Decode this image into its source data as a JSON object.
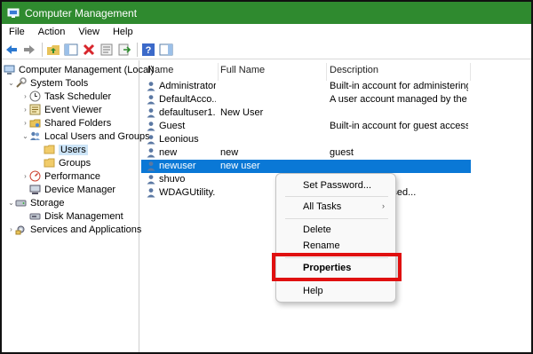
{
  "window": {
    "title": "Computer Management"
  },
  "menu": [
    "File",
    "Action",
    "View",
    "Help"
  ],
  "toolbar": {
    "buttons": [
      "back-icon",
      "forward-icon",
      "up-folder-icon",
      "show-hide-tree-icon",
      "delete-icon",
      "properties-icon",
      "export-icon",
      "help-icon",
      "action-pane-icon"
    ]
  },
  "tree": {
    "root": "Computer Management (Local)",
    "system_tools": "System Tools",
    "task_scheduler": "Task Scheduler",
    "event_viewer": "Event Viewer",
    "shared_folders": "Shared Folders",
    "local_users_groups": "Local Users and Groups",
    "users": "Users",
    "groups": "Groups",
    "performance": "Performance",
    "device_manager": "Device Manager",
    "storage": "Storage",
    "disk_management": "Disk Management",
    "services_apps": "Services and Applications"
  },
  "columns": {
    "name": "Name",
    "full_name": "Full Name",
    "description": "Description"
  },
  "users": [
    {
      "name": "Administrator",
      "full_name": "",
      "description": "Built-in account for administering ..."
    },
    {
      "name": "DefaultAcco...",
      "full_name": "",
      "description": "A user account managed by the sy..."
    },
    {
      "name": "defaultuser1...",
      "full_name": "New User",
      "description": ""
    },
    {
      "name": "Guest",
      "full_name": "",
      "description": "Built-in account for guest access t..."
    },
    {
      "name": "Leonious",
      "full_name": "",
      "description": ""
    },
    {
      "name": "new",
      "full_name": "new",
      "description": "guest"
    },
    {
      "name": "newuser",
      "full_name": "new user",
      "description": "",
      "selected": true
    },
    {
      "name": "shuvo",
      "full_name": "",
      "description": ""
    },
    {
      "name": "WDAGUtility...",
      "full_name": "",
      "description": "...naged and used..."
    }
  ],
  "context_menu": {
    "set_password": "Set Password...",
    "all_tasks": "All Tasks",
    "delete": "Delete",
    "rename": "Rename",
    "properties": "Properties",
    "help": "Help"
  },
  "colors": {
    "titlebar": "#2f8a2f",
    "selection": "#0a78d6",
    "highlight_box": "#e01010"
  }
}
